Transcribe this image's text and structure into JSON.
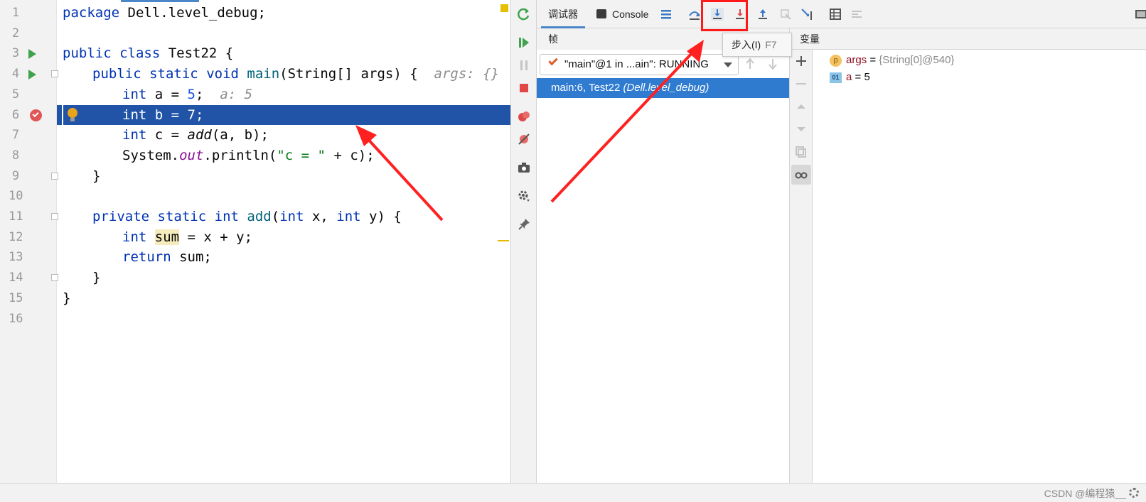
{
  "editor": {
    "line_numbers": [
      "1",
      "2",
      "3",
      "4",
      "5",
      "6",
      "7",
      "8",
      "9",
      "10",
      "11",
      "12",
      "13",
      "14",
      "15",
      "16"
    ],
    "lines": {
      "l1_kw": "package",
      "l1_rest": " Dell.level_debug;",
      "l3_kw1": "public",
      "l3_kw2": "class",
      "l3_rest": " Test22 {",
      "l4_kw1": "public",
      "l4_kw2": "static",
      "l4_kw3": "void",
      "l4_fn": "main",
      "l4_rest": "(String[] args) {",
      "l4_hint": "args: {}",
      "l5_kw": "int",
      "l5_a": " a = ",
      "l5_num": "5",
      "l5_semi": ";",
      "l5_hint": "a: 5",
      "l6_text": "int b = 7;",
      "l7_kw": "int",
      "l7_a": " c = ",
      "l7_fn": "add",
      "l7_rest": "(a, b);",
      "l8_a": "System.",
      "l8_field": "out",
      "l8_b": ".println(",
      "l8_str": "\"c = \"",
      "l8_c": " + c);",
      "l9_text": "}",
      "l11_kw1": "private",
      "l11_kw2": "static",
      "l11_kw3": "int",
      "l11_fn": "add",
      "l11_a": "(",
      "l11_kw4": "int",
      "l11_b": " x, ",
      "l11_kw5": "int",
      "l11_c": " y) {",
      "l12_kw": "int",
      "l12_var": "sum",
      "l12_rest": " = x + y;",
      "l13_kw": "return",
      "l13_rest": " sum;",
      "l14_text": "}",
      "l15_text": "}"
    }
  },
  "debugger": {
    "tabs": {
      "debugger": "调试器",
      "console": "Console"
    },
    "tooltip": {
      "label": "步入(I)",
      "shortcut": "F7"
    },
    "frames_header": "帧",
    "thread_select": "\"main\"@1 in ...ain\": RUNNING",
    "frame_row": {
      "method": "main:6, Test22",
      "package": "(Dell.level_debug)"
    },
    "variables_header": "变量",
    "variables": [
      {
        "badge": "p",
        "name": "args",
        "value": "{String[0]@540}"
      },
      {
        "badge": "01",
        "name": "a",
        "eq": " = ",
        "value": "5"
      }
    ]
  },
  "statusbar": {
    "watermark": "CSDN @编程猿__"
  },
  "colors": {
    "accent": "#2154a7",
    "annotation": "#ff1a1a",
    "selection": "#2e7bcf"
  }
}
